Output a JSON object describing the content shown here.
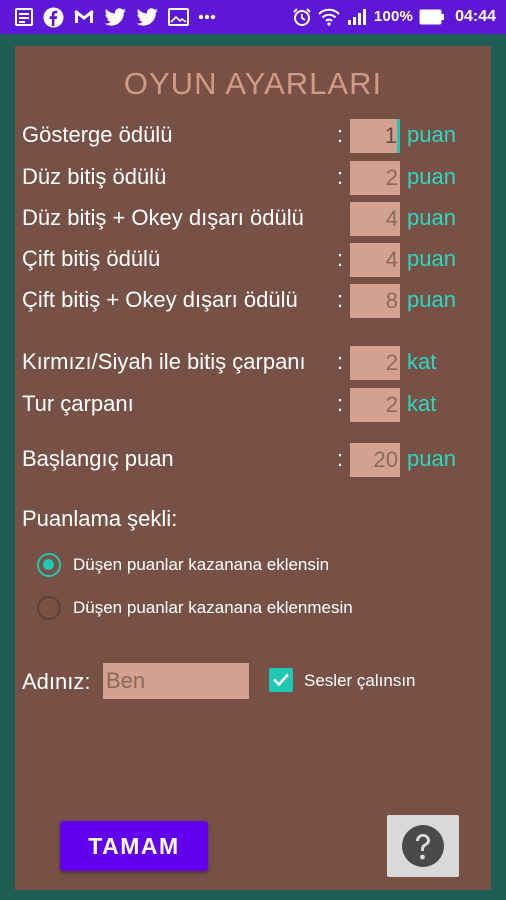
{
  "status_bar": {
    "battery_text": "100%",
    "time": "04:44",
    "left_icons": [
      "notes-icon",
      "facebook-icon",
      "gmail-icon",
      "twitter-icon",
      "twitter-icon",
      "gallery-icon",
      "more-dots-icon"
    ],
    "right_icons": [
      "alarm-icon",
      "wifi-icon",
      "signal-icon",
      "battery-icon"
    ]
  },
  "screen": {
    "title": "OYUN AYARLARI"
  },
  "settings": {
    "gosterge": {
      "label": "Gösterge ödülü",
      "colon": ":",
      "value": "1",
      "unit": "puan"
    },
    "duz_bitis": {
      "label": "Düz bitiş ödülü",
      "colon": ":",
      "value": "2",
      "unit": "puan"
    },
    "duz_okey": {
      "label": "Düz bitiş + Okey dışarı ödülü",
      "colon": ":",
      "value": "4",
      "unit": "puan"
    },
    "cift_bitis": {
      "label": "Çift bitiş ödülü",
      "colon": ":",
      "value": "4",
      "unit": "puan"
    },
    "cift_okey": {
      "label": "Çift bitiş + Okey dışarı ödülü",
      "colon": ":",
      "value": "8",
      "unit": "puan"
    },
    "kirmizi_siyah": {
      "label": "Kırmızı/Siyah ile bitiş çarpanı",
      "colon": ":",
      "value": "2",
      "unit": "kat"
    },
    "tur_carpani": {
      "label": "Tur çarpanı",
      "colon": ":",
      "value": "2",
      "unit": "kat"
    },
    "baslangic": {
      "label": "Başlangıç puan",
      "colon": ":",
      "value": "20",
      "unit": "puan"
    }
  },
  "scoring": {
    "label": "Puanlama şekli:",
    "options": [
      {
        "label": "Düşen puanlar kazanana eklensin",
        "selected": true
      },
      {
        "label": "Düşen puanlar kazanana eklenmesin",
        "selected": false
      }
    ]
  },
  "player": {
    "name_label": "Adınız:",
    "name_value": "Ben",
    "sound_label": "Sesler çalınsın",
    "sound_checked": true
  },
  "actions": {
    "ok_label": "TAMAM",
    "help_icon": "question-mark-icon"
  },
  "colors": {
    "status_bar": "#5e17d9",
    "background": "#1f5e55",
    "panel": "#775145",
    "title": "#d29a83",
    "input_bg": "#d4a08f",
    "accent": "#1fc7b4",
    "button": "#6200ee"
  }
}
